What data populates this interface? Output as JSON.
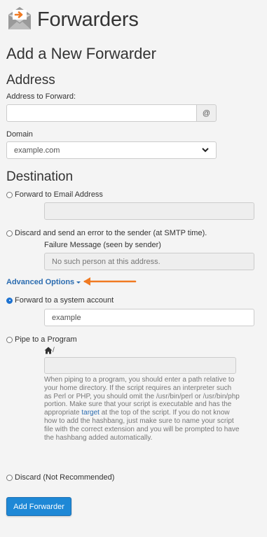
{
  "header": {
    "title": "Forwarders",
    "logo_icon": "envelope-forward-icon"
  },
  "form": {
    "title": "Add a New Forwarder",
    "address": {
      "heading": "Address",
      "address_label": "Address to Forward:",
      "address_value": "",
      "at_symbol": "@",
      "domain_label": "Domain",
      "domain_value": "example.com"
    },
    "destination": {
      "heading": "Destination",
      "forward_email_label": "Forward to Email Address",
      "forward_email_value": "",
      "discard_error_label": "Discard and send an error to the sender (at SMTP time).",
      "failure_message_label": "Failure Message (seen by sender)",
      "failure_message_placeholder": "No such person at this address.",
      "advanced_options_label": "Advanced Options",
      "system_account_label": "Forward to a system account",
      "system_account_value": "example",
      "pipe_label": "Pipe to a Program",
      "home_path_suffix": "/",
      "pipe_value": "",
      "help_text_before_link": "When piping to a program, you should enter a path relative to your home directory. If the script requires an interpreter such as Perl or PHP, you should omit the /usr/bin/perl or /usr/bin/php portion. Make sure that your script is executable and has the appropriate ",
      "help_link": "target",
      "help_text_after_link": " at the top of the script. If you do not know how to add the hashbang, just make sure to name your script file with the correct extension and you will be prompted to have the hashbang added automatically.",
      "discard_label": "Discard (Not Recommended)",
      "selected_option": "Forward to a system account"
    },
    "submit_label": "Add Forwarder"
  },
  "colors": {
    "accent": "#1e88d6",
    "link": "#2b6cb0",
    "annotation_arrow": "#f07a22",
    "logo_orange": "#f07a22"
  }
}
